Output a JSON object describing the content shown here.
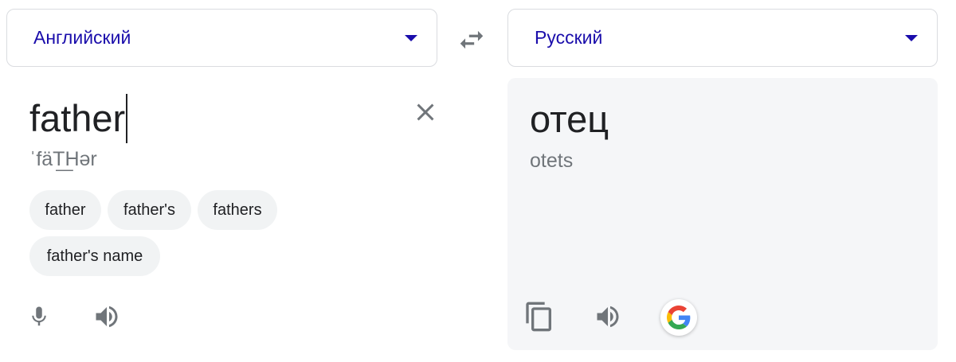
{
  "source": {
    "language": "Английский",
    "text": "father",
    "pronunciation": "ˈfäT͟Hər",
    "suggestions": [
      "father",
      "father's",
      "fathers",
      "father's name"
    ]
  },
  "target": {
    "language": "Русский",
    "text": "отец",
    "transliteration": "otets"
  },
  "icons": {
    "swap": "swap-arrows-icon",
    "clear": "close-icon",
    "mic": "microphone-icon",
    "speaker": "speaker-icon",
    "copy": "copy-icon",
    "google": "google-logo-icon",
    "dropdown": "chevron-down-icon"
  },
  "colors": {
    "accent": "#1a0dab",
    "icon_gray": "#70757a",
    "target_bg": "#f5f6f8",
    "chip_bg": "#f1f3f4"
  }
}
